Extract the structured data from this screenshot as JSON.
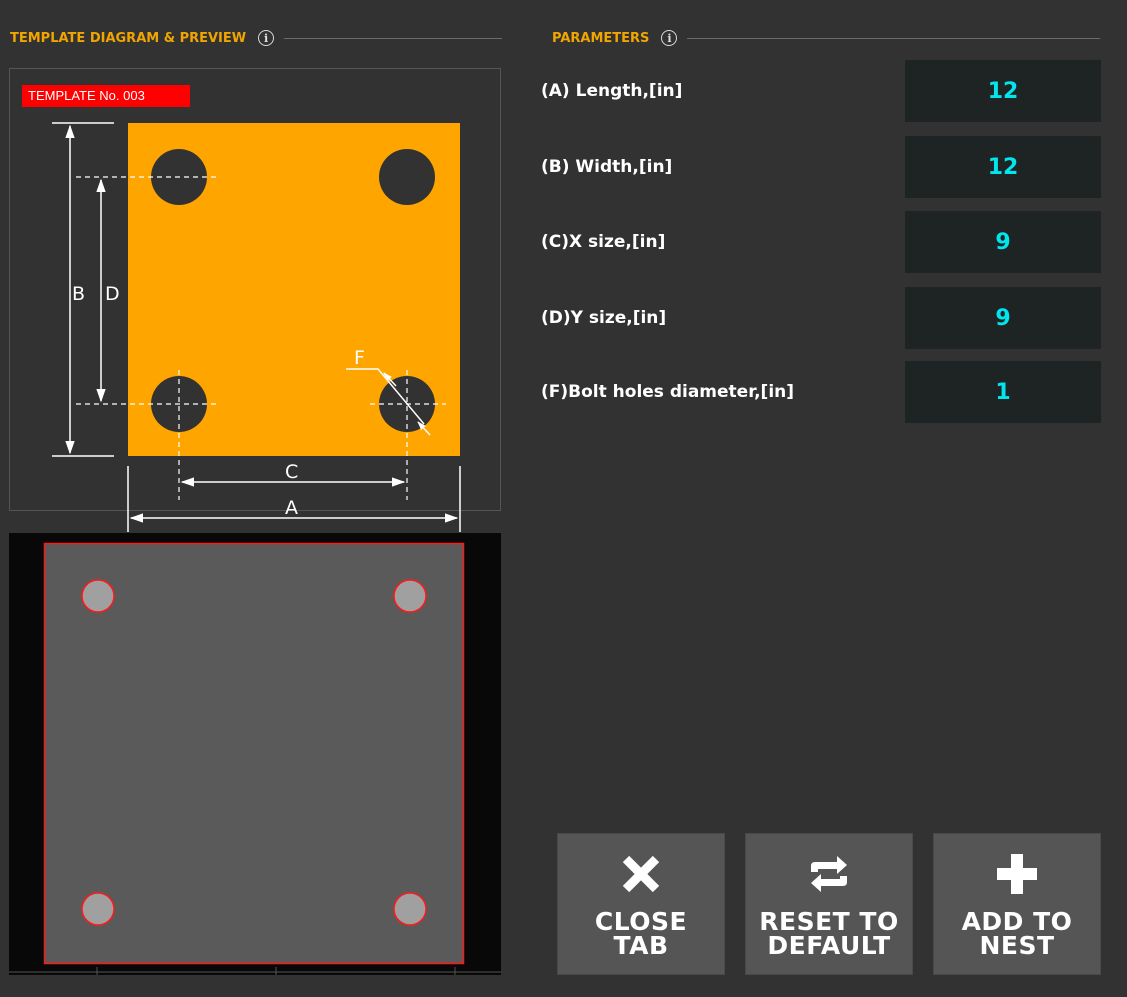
{
  "diagram_section": {
    "title": "TEMPLATE DIAGRAM & PREVIEW",
    "template_badge": "TEMPLATE No. 003",
    "dimension_labels": {
      "a": "A",
      "b": "B",
      "c": "C",
      "d": "D",
      "f": "F"
    }
  },
  "parameters_section": {
    "title": "PARAMETERS"
  },
  "parameters": [
    {
      "label": "(A) Length,[in]",
      "value": "12"
    },
    {
      "label": "(B) Width,[in]",
      "value": "12"
    },
    {
      "label": "(C)X size,[in]",
      "value": "9"
    },
    {
      "label": "(D)Y size,[in]",
      "value": "9"
    },
    {
      "label": "(F)Bolt holes diameter,[in]",
      "value": "1"
    }
  ],
  "buttons": {
    "close_tab": {
      "line1": "CLOSE",
      "line2": "TAB",
      "icon": "close-x-icon"
    },
    "reset_default": {
      "line1": "RESET TO",
      "line2": "DEFAULT",
      "icon": "reset-icon"
    },
    "add_to_nest": {
      "line1": "ADD TO",
      "line2": "NEST",
      "icon": "plus-icon"
    }
  },
  "colors": {
    "accent": "#f0a500",
    "plate": "#ffa500",
    "hole": "#323232",
    "badge": "#ff0000",
    "input_text": "#00e5ee",
    "preview_plate": "#5a5a5a",
    "preview_outline": "#ff1a1a",
    "preview_hole": "#a0a0a0"
  }
}
